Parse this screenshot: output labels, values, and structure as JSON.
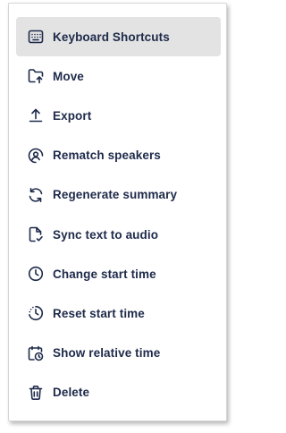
{
  "menu": {
    "items": [
      {
        "label": "Keyboard Shortcuts",
        "icon": "keyboard-icon",
        "active": true
      },
      {
        "label": "Move",
        "icon": "folder-move-icon"
      },
      {
        "label": "Export",
        "icon": "export-icon"
      },
      {
        "label": "Rematch speakers",
        "icon": "speaker-icon"
      },
      {
        "label": "Regenerate summary",
        "icon": "refresh-icon"
      },
      {
        "label": "Sync text to audio",
        "icon": "file-sync-icon"
      },
      {
        "label": "Change start time",
        "icon": "clock-icon"
      },
      {
        "label": "Reset start time",
        "icon": "clock-reset-icon"
      },
      {
        "label": "Show relative time",
        "icon": "calendar-clock-icon"
      },
      {
        "label": "Delete",
        "icon": "trash-icon"
      }
    ]
  },
  "colors": {
    "text": "#1e2a4a",
    "active_bg": "#e3e3e3",
    "border": "#d6d6d6"
  }
}
